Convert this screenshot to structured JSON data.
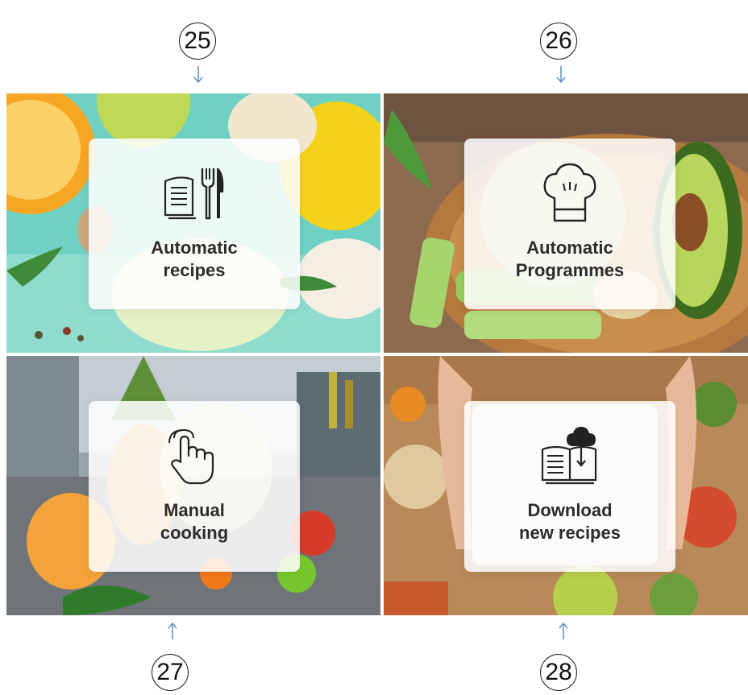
{
  "callouts": {
    "top_left": "25",
    "top_right": "26",
    "bottom_left": "27",
    "bottom_right": "28"
  },
  "tiles": {
    "automatic_recipes": {
      "line1": "Automatic",
      "line2": "recipes",
      "icon": "recipe-book-cutlery-icon"
    },
    "automatic_programmes": {
      "line1": "Automatic",
      "line2": "Programmes",
      "icon": "chef-hat-icon"
    },
    "manual_cooking": {
      "line1": "Manual",
      "line2": "cooking",
      "icon": "touch-hand-icon"
    },
    "download_recipes": {
      "line1": "Download",
      "line2": "new recipes",
      "icon": "cloud-download-book-icon"
    }
  },
  "colors": {
    "arrow": "#5b8fc7",
    "card_text": "#2c2c2c",
    "card_bg": "#ffffff"
  }
}
